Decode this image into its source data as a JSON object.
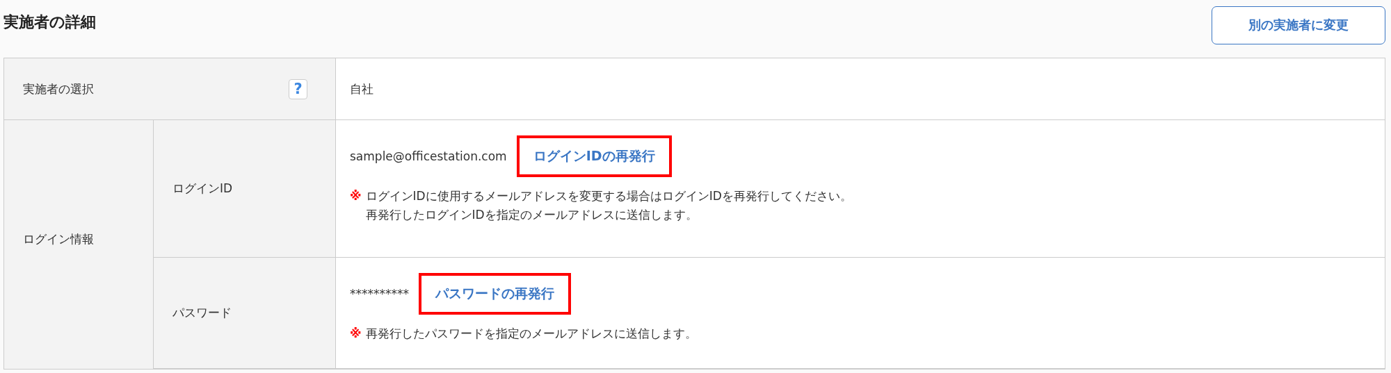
{
  "heading": "実施者の詳細",
  "change_button": "別の実施者に変更",
  "rows": [
    {
      "kind": "single",
      "label": "実施者の選択",
      "help": "?",
      "value": "自社"
    },
    {
      "kind": "group",
      "label": "ログイン情報",
      "children": [
        {
          "label": "ログインID",
          "value": "sample@officestation.com",
          "action": {
            "label": "ログインIDの再発行",
            "highlighted": true
          },
          "note": {
            "mark": "※",
            "lines": [
              "ログインIDに使用するメールアドレスを変更する場合はログインIDを再発行してください。",
              "再発行したログインIDを指定のメールアドレスに送信します。"
            ]
          }
        },
        {
          "label": "パスワード",
          "value": "**********",
          "action": {
            "label": "パスワードの再発行",
            "highlighted": true
          },
          "note": {
            "mark": "※",
            "lines": [
              "再発行したパスワードを指定のメールアドレスに送信します。"
            ]
          }
        }
      ]
    }
  ]
}
